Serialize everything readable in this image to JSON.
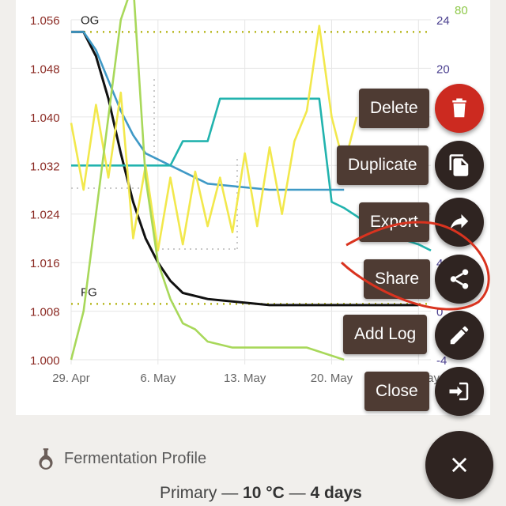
{
  "chart_data": {
    "type": "line",
    "x_ticks": [
      "29. Apr",
      "6. May",
      "13. May",
      "20. May",
      "27. May"
    ],
    "x_range": [
      "2019-04-29",
      "2019-05-28"
    ],
    "y_left_ticks": [
      "1.056",
      "1.048",
      "1.040",
      "1.032",
      "1.024",
      "1.016",
      "1.008",
      "1.000"
    ],
    "y_left_range": [
      1.0,
      1.056
    ],
    "y_right_ticks": [
      "24",
      "20",
      "4",
      "0",
      "-4"
    ],
    "y_right_range": [
      -4,
      24
    ],
    "y_right_top_label": "80",
    "reference_lines": [
      {
        "label": "OG",
        "value": 1.054
      },
      {
        "label": "FG",
        "value": 1.0092
      }
    ],
    "grid": true,
    "series": [
      {
        "color": "#111111",
        "x": [
          "2019-04-29",
          "2019-04-30",
          "2019-05-01",
          "2019-05-02",
          "2019-05-03",
          "2019-05-04",
          "2019-05-05",
          "2019-05-06",
          "2019-05-07",
          "2019-05-08",
          "2019-05-10",
          "2019-05-15",
          "2019-05-20",
          "2019-05-25",
          "2019-05-27"
        ],
        "y": [
          1.054,
          1.054,
          1.05,
          1.043,
          1.034,
          1.026,
          1.02,
          1.016,
          1.013,
          1.011,
          1.01,
          1.009,
          1.009,
          1.009,
          1.009
        ]
      },
      {
        "color": "#3f99c6",
        "x": [
          "2019-04-29",
          "2019-04-30",
          "2019-05-01",
          "2019-05-02",
          "2019-05-03",
          "2019-05-04",
          "2019-05-05",
          "2019-05-07",
          "2019-05-10",
          "2019-05-15",
          "2019-05-20",
          "2019-05-21"
        ],
        "y": [
          1.054,
          1.054,
          1.051,
          1.046,
          1.041,
          1.037,
          1.034,
          1.032,
          1.029,
          1.028,
          1.028,
          1.028
        ]
      },
      {
        "color": "#22b3ae",
        "x": [
          "2019-04-29",
          "2019-05-07",
          "2019-05-08",
          "2019-05-10",
          "2019-05-11",
          "2019-05-15",
          "2019-05-19",
          "2019-05-20",
          "2019-05-21",
          "2019-05-24",
          "2019-05-27",
          "2019-05-28"
        ],
        "y": [
          1.032,
          1.032,
          1.036,
          1.036,
          1.043,
          1.043,
          1.043,
          1.026,
          1.025,
          1.021,
          1.019,
          1.018
        ]
      },
      {
        "color": "#f2e84c",
        "x": [
          "2019-04-29",
          "2019-04-30",
          "2019-05-01",
          "2019-05-02",
          "2019-05-03",
          "2019-05-04",
          "2019-05-05",
          "2019-05-06",
          "2019-05-07",
          "2019-05-08",
          "2019-05-09",
          "2019-05-10",
          "2019-05-11",
          "2019-05-12",
          "2019-05-13",
          "2019-05-14",
          "2019-05-15",
          "2019-05-16",
          "2019-05-17",
          "2019-05-18",
          "2019-05-19",
          "2019-05-20",
          "2019-05-21",
          "2019-05-22"
        ],
        "y": [
          1.039,
          1.028,
          1.042,
          1.03,
          1.044,
          1.02,
          1.032,
          1.018,
          1.03,
          1.019,
          1.031,
          1.022,
          1.03,
          1.021,
          1.034,
          1.022,
          1.035,
          1.024,
          1.036,
          1.041,
          1.055,
          1.04,
          1.032,
          1.04
        ]
      },
      {
        "color": "#a8d85a",
        "x": [
          "2019-04-29",
          "2019-04-30",
          "2019-05-01",
          "2019-05-02",
          "2019-05-03",
          "2019-05-04",
          "2019-05-05",
          "2019-05-06",
          "2019-05-07",
          "2019-05-08",
          "2019-05-09",
          "2019-05-10",
          "2019-05-12",
          "2019-05-15",
          "2019-05-18",
          "2019-05-21"
        ],
        "y": [
          1.0,
          1.008,
          1.024,
          1.04,
          1.056,
          1.062,
          1.03,
          1.016,
          1.01,
          1.006,
          1.005,
          1.003,
          1.002,
          1.002,
          1.002,
          1.0
        ]
      }
    ]
  },
  "actions": [
    {
      "label": "Delete",
      "icon": "trash-icon",
      "fab_color": "#cc2a20"
    },
    {
      "label": "Duplicate",
      "icon": "copy-icon",
      "fab_color": "#2f2421"
    },
    {
      "label": "Export",
      "icon": "share-arrow-icon",
      "fab_color": "#2f2421"
    },
    {
      "label": "Share",
      "icon": "share-icon",
      "fab_color": "#2f2421"
    },
    {
      "label": "Add Log",
      "icon": "pencil-icon",
      "fab_color": "#2f2421"
    },
    {
      "label": "Close",
      "icon": "exit-icon",
      "fab_color": "#2f2421"
    }
  ],
  "main_fab": {
    "icon": "close-icon",
    "color": "#2f2421"
  },
  "section": {
    "icon": "flask-icon",
    "title": "Fermentation Profile"
  },
  "stage": {
    "name": "Primary",
    "sep1": "—",
    "temp": "10 °C",
    "sep2": "—",
    "duration": "4 days"
  },
  "colors": {
    "left_axis": "#8b2a23",
    "right_axis": "#4a3f8f",
    "right_top": "#8fc94a",
    "annotation": "#d9331f",
    "ref_line": "#b8b820"
  }
}
